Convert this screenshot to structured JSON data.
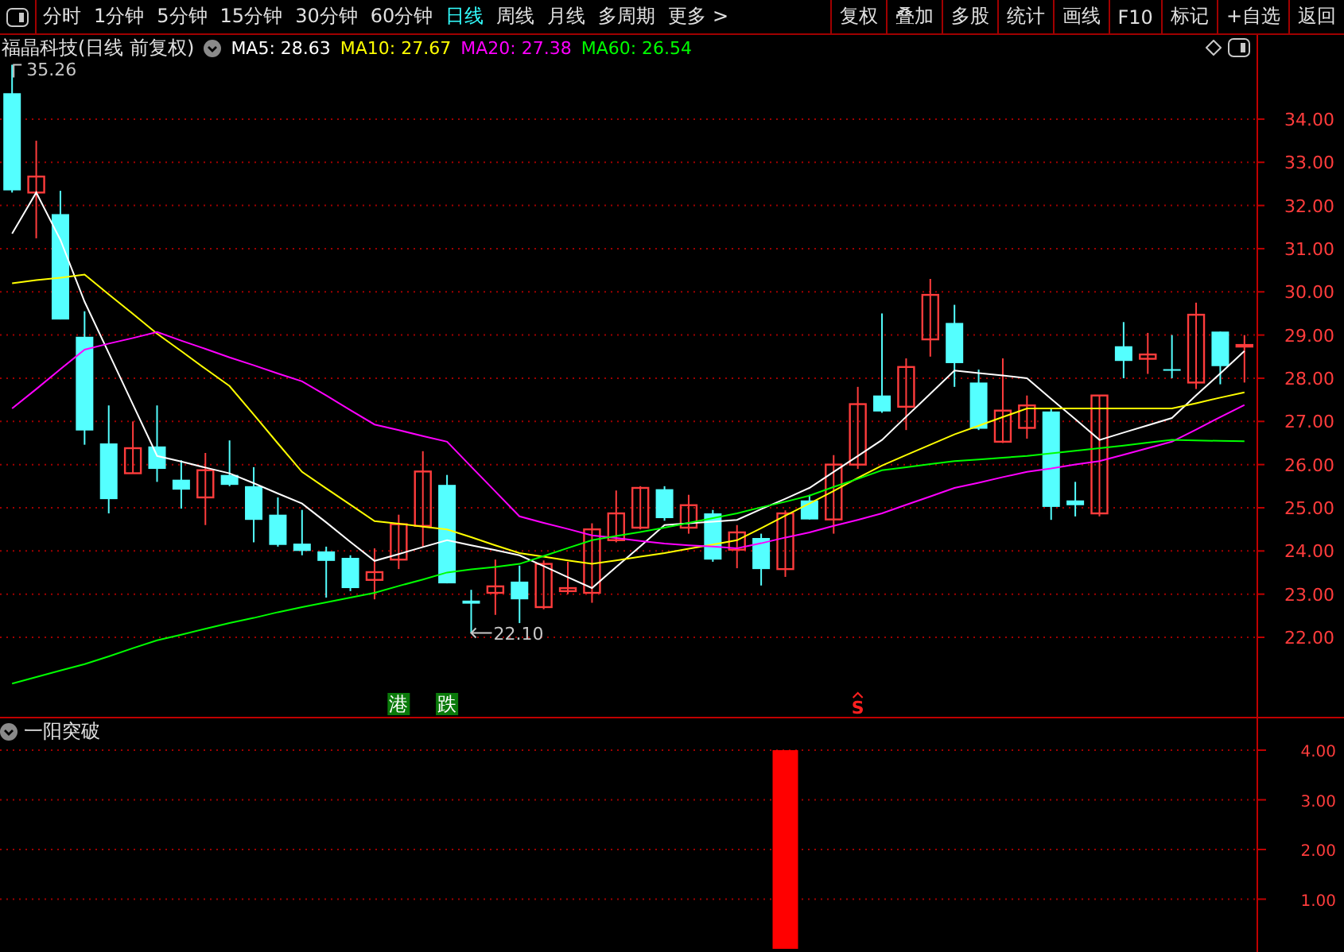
{
  "toolbar": {
    "periods": [
      {
        "label": "分时",
        "selected": false
      },
      {
        "label": "1分钟",
        "selected": false
      },
      {
        "label": "5分钟",
        "selected": false
      },
      {
        "label": "15分钟",
        "selected": false
      },
      {
        "label": "30分钟",
        "selected": false
      },
      {
        "label": "60分钟",
        "selected": false
      },
      {
        "label": "日线",
        "selected": true
      },
      {
        "label": "周线",
        "selected": false
      },
      {
        "label": "月线",
        "selected": false
      },
      {
        "label": "多周期",
        "selected": false
      },
      {
        "label": "更多 >",
        "selected": false
      }
    ],
    "buttons": [
      "复权",
      "叠加",
      "多股",
      "统计",
      "画线",
      "F10",
      "标记",
      "+自选",
      "返回"
    ]
  },
  "main_chart": {
    "title": "福晶科技(日线 前复权)",
    "chart_data": {
      "type": "candlestick",
      "ylim": [
        20.16,
        35.36
      ],
      "yticks": [
        {
          "value": 34,
          "label": "34.00"
        },
        {
          "value": 33,
          "label": "33.00"
        },
        {
          "value": 32,
          "label": "32.00"
        },
        {
          "value": 31,
          "label": "31.00"
        },
        {
          "value": 30,
          "label": "30.00"
        },
        {
          "value": 29,
          "label": "29.00"
        },
        {
          "value": 28,
          "label": "28.00"
        },
        {
          "value": 27,
          "label": "27.00"
        },
        {
          "value": 26,
          "label": "26.00"
        },
        {
          "value": 25,
          "label": "25.00"
        },
        {
          "value": 24,
          "label": "24.00"
        },
        {
          "value": 23,
          "label": "23.00"
        },
        {
          "value": 22,
          "label": "22.00"
        }
      ],
      "grid": true,
      "ohlc": [
        [
          34.6,
          35.26,
          32.3,
          32.35
        ],
        [
          32.3,
          33.5,
          31.24,
          32.67
        ],
        [
          31.8,
          32.34,
          29.36,
          29.36
        ],
        [
          28.96,
          29.55,
          26.46,
          26.79
        ],
        [
          26.49,
          27.37,
          24.87,
          25.2
        ],
        [
          25.8,
          27.0,
          25.8,
          26.38
        ],
        [
          26.42,
          27.37,
          25.6,
          25.9
        ],
        [
          25.65,
          26.1,
          24.98,
          25.42
        ],
        [
          25.24,
          26.27,
          24.6,
          25.87
        ],
        [
          25.76,
          26.56,
          25.5,
          25.53
        ],
        [
          25.5,
          25.94,
          24.2,
          24.72
        ],
        [
          24.84,
          25.24,
          24.1,
          24.14
        ],
        [
          24.17,
          24.95,
          23.9,
          24.0
        ],
        [
          23.99,
          24.1,
          22.92,
          23.77
        ],
        [
          23.84,
          23.9,
          23.07,
          23.14
        ],
        [
          23.33,
          24.06,
          22.88,
          23.51
        ],
        [
          23.8,
          24.84,
          23.58,
          24.62
        ],
        [
          24.58,
          26.31,
          24.1,
          25.84
        ],
        [
          25.53,
          25.76,
          23.25,
          23.25
        ],
        [
          22.85,
          23.1,
          22.1,
          22.78
        ],
        [
          23.03,
          23.8,
          22.52,
          23.18
        ],
        [
          23.29,
          23.66,
          22.33,
          22.88
        ],
        [
          22.7,
          23.78,
          22.65,
          23.7
        ],
        [
          23.07,
          23.75,
          23.0,
          23.14
        ],
        [
          23.03,
          24.64,
          22.8,
          24.5
        ],
        [
          24.25,
          25.4,
          24.2,
          24.87
        ],
        [
          24.54,
          25.5,
          24.5,
          25.46
        ],
        [
          25.43,
          25.5,
          24.7,
          24.76
        ],
        [
          24.54,
          25.3,
          24.4,
          25.06
        ],
        [
          24.87,
          24.95,
          23.75,
          23.8
        ],
        [
          24.03,
          24.6,
          23.6,
          24.43
        ],
        [
          24.3,
          24.4,
          23.2,
          23.58
        ],
        [
          23.58,
          24.94,
          23.4,
          24.87
        ],
        [
          25.17,
          25.3,
          24.73,
          24.73
        ],
        [
          24.73,
          26.22,
          24.4,
          26.0
        ],
        [
          26.0,
          27.8,
          25.9,
          27.4
        ],
        [
          27.6,
          29.5,
          27.2,
          27.23
        ],
        [
          27.34,
          28.46,
          26.8,
          28.26
        ],
        [
          28.9,
          30.3,
          28.5,
          29.93
        ],
        [
          29.28,
          29.7,
          27.8,
          28.35
        ],
        [
          27.9,
          28.2,
          26.8,
          26.83
        ],
        [
          26.53,
          28.46,
          26.5,
          27.25
        ],
        [
          26.85,
          27.6,
          26.6,
          27.37
        ],
        [
          27.23,
          27.3,
          24.72,
          25.02
        ],
        [
          25.17,
          25.6,
          24.8,
          25.06
        ],
        [
          24.87,
          27.6,
          24.8,
          27.6
        ],
        [
          28.74,
          29.3,
          28.0,
          28.4
        ],
        [
          28.45,
          29.05,
          28.1,
          28.55
        ],
        [
          28.21,
          29.0,
          28.0,
          28.19
        ],
        [
          27.9,
          29.75,
          27.75,
          29.47
        ],
        [
          29.08,
          29.08,
          27.86,
          28.28
        ],
        [
          28.75,
          29.0,
          27.9,
          28.77
        ]
      ],
      "series": [
        {
          "name": "MA5: 28.63",
          "type": "line",
          "color": "#ffffff",
          "values": [
            31.35,
            32.3,
            31.2,
            29.77,
            28.58,
            27.39,
            26.2,
            26.07,
            25.93,
            25.8,
            25.57,
            25.33,
            25.1,
            24.66,
            24.21,
            23.77,
            23.93,
            24.09,
            24.25,
            24.13,
            24.02,
            23.9,
            23.65,
            23.39,
            23.14,
            23.63,
            24.11,
            24.6,
            24.64,
            24.68,
            24.72,
            24.97,
            25.21,
            25.46,
            25.83,
            26.2,
            26.57,
            27.11,
            27.64,
            28.18,
            28.12,
            28.06,
            28.0,
            27.52,
            27.05,
            26.57,
            26.74,
            26.91,
            27.08,
            27.6,
            28.11,
            28.63
          ]
        },
        {
          "name": "MA10: 27.67",
          "type": "line",
          "color": "#ffff00",
          "values": [
            30.2,
            30.27,
            30.33,
            30.4,
            29.94,
            29.49,
            29.03,
            28.63,
            28.22,
            27.82,
            27.16,
            26.49,
            25.83,
            25.45,
            25.07,
            24.69,
            24.63,
            24.56,
            24.5,
            24.32,
            24.13,
            23.95,
            23.87,
            23.78,
            23.7,
            23.78,
            23.87,
            23.95,
            24.05,
            24.15,
            24.25,
            24.53,
            24.82,
            25.1,
            25.39,
            25.69,
            25.98,
            26.22,
            26.46,
            26.7,
            26.9,
            27.1,
            27.3,
            27.3,
            27.3,
            27.3,
            27.3,
            27.3,
            27.3,
            27.42,
            27.55,
            27.67
          ]
        },
        {
          "name": "MA20: 27.38",
          "type": "line",
          "color": "#ff00ff",
          "values": [
            27.3,
            27.75,
            28.21,
            28.66,
            28.8,
            28.93,
            29.07,
            28.87,
            28.68,
            28.48,
            28.3,
            28.11,
            27.93,
            27.6,
            27.26,
            26.93,
            26.8,
            26.66,
            26.53,
            25.95,
            25.38,
            24.8,
            24.65,
            24.51,
            24.36,
            24.3,
            24.23,
            24.17,
            24.13,
            24.1,
            24.06,
            24.18,
            24.31,
            24.43,
            24.58,
            24.72,
            24.87,
            25.07,
            25.26,
            25.46,
            25.58,
            25.71,
            25.83,
            25.91,
            26.0,
            26.08,
            26.23,
            26.38,
            26.53,
            26.81,
            27.1,
            27.38
          ]
        },
        {
          "name": "MA60: 26.54",
          "type": "line",
          "color": "#00ff00",
          "values": [
            20.93,
            21.08,
            21.23,
            21.38,
            21.56,
            21.75,
            21.93,
            22.06,
            22.2,
            22.33,
            22.45,
            22.58,
            22.7,
            22.81,
            22.92,
            23.03,
            23.19,
            23.34,
            23.5,
            23.57,
            23.63,
            23.7,
            23.88,
            24.07,
            24.25,
            24.35,
            24.44,
            24.54,
            24.65,
            24.76,
            24.87,
            25.01,
            25.14,
            25.28,
            25.48,
            25.67,
            25.87,
            25.94,
            26.01,
            26.08,
            26.12,
            26.16,
            26.2,
            26.26,
            26.32,
            26.38,
            26.44,
            26.51,
            26.57,
            26.56,
            26.55,
            26.54
          ]
        }
      ],
      "annotations": [
        "35.26",
        "22.10",
        "港",
        "跌",
        "S"
      ]
    }
  },
  "indicator_panel": {
    "title": "一阳突破",
    "chart_data": {
      "type": "bar",
      "ylim": [
        0,
        4
      ],
      "grid": true,
      "yticks": [
        {
          "value": 4,
          "label": "4.00"
        },
        {
          "value": 3,
          "label": "3.00"
        },
        {
          "value": 2,
          "label": "2.00"
        },
        {
          "value": 1,
          "label": "1.00"
        }
      ],
      "values": [
        0,
        0,
        0,
        0,
        0,
        0,
        0,
        0,
        0,
        0,
        0,
        0,
        0,
        0,
        0,
        0,
        0,
        0,
        0,
        0,
        0,
        0,
        0,
        0,
        0,
        0,
        0,
        0,
        0,
        0,
        0,
        0,
        4,
        0,
        0,
        0,
        0,
        0,
        0,
        0,
        0,
        0,
        0,
        0,
        0,
        0,
        0,
        0,
        0,
        0,
        0,
        0
      ]
    }
  }
}
